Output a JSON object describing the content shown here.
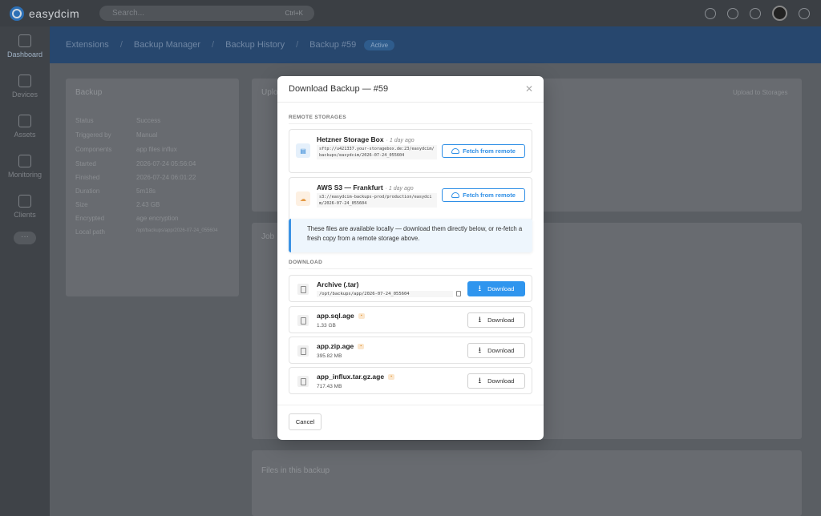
{
  "app": {
    "logo_text": "easydcim"
  },
  "search": {
    "placeholder": "Search...",
    "shortcut": "Ctrl+K"
  },
  "sidebar": {
    "items": [
      {
        "label": "Dashboard"
      },
      {
        "label": "Devices"
      },
      {
        "label": "Assets"
      },
      {
        "label": "Monitoring"
      },
      {
        "label": "Clients"
      }
    ],
    "more": "···"
  },
  "breadcrumb": {
    "items": [
      "Extensions",
      "Backup Manager",
      "Backup History",
      "Backup #59"
    ],
    "badge": "Active"
  },
  "background": {
    "left_panel_title": "Backup",
    "rows": [
      {
        "label": "Status",
        "value": "Success"
      },
      {
        "label": "Triggered by",
        "value": "Manual"
      },
      {
        "label": "Components",
        "value": "app  files  influx"
      },
      {
        "label": "Started",
        "value": "2026-07-24 05:56:04"
      },
      {
        "label": "Finished",
        "value": "2026-07-24 06:01:22"
      },
      {
        "label": "Duration",
        "value": "5m18s"
      },
      {
        "label": "Size",
        "value": "2.43 GB"
      },
      {
        "label": "Encrypted",
        "value": "age encryption"
      },
      {
        "label": "Local path",
        "value": "/opt/backups/app/2026-07-24_055604"
      }
    ],
    "right_panel_title": "Uploads",
    "upload_button": "Upload to Storages",
    "jobs_title": "Job",
    "files_title": "Files in this backup"
  },
  "modal": {
    "title": "Download Backup — #59",
    "remote_section_label": "REMOTE STORAGES",
    "storages": [
      {
        "name": "Hetzner Storage Box",
        "age": "· 1 day ago",
        "path": "sftp://u421337.your-storagebox.de:23/easydcim/backups/easydcim/2026-07-24_055604",
        "button": "Fetch from remote",
        "icon": "server-icon"
      },
      {
        "name": "AWS S3 — Frankfurt",
        "age": "· 1 day ago",
        "path": "s3://easydcim-backups-prod/production/easydcim/2026-07-24_055604",
        "button": "Fetch from remote",
        "icon": "cloud-icon"
      }
    ],
    "info_text": "These files are available locally — download them directly below, or re-fetch a fresh copy from a remote storage above.",
    "download_section_label": "DOWNLOAD",
    "files": [
      {
        "name": "Archive (.tar)",
        "path": "/opt/backups/app/2026-07-24_055604",
        "button": "Download"
      },
      {
        "name": "app.sql.age",
        "size": "1.33 GB",
        "button": "Download"
      },
      {
        "name": "app.zip.age",
        "size": "395.82 MB",
        "button": "Download"
      },
      {
        "name": "app_influx.tar.gz.age",
        "size": "717.43 MB",
        "button": "Download"
      }
    ],
    "cancel_label": "Cancel"
  },
  "colors": {
    "primary": "#2f95ee",
    "accent_orange": "#e49a45"
  }
}
